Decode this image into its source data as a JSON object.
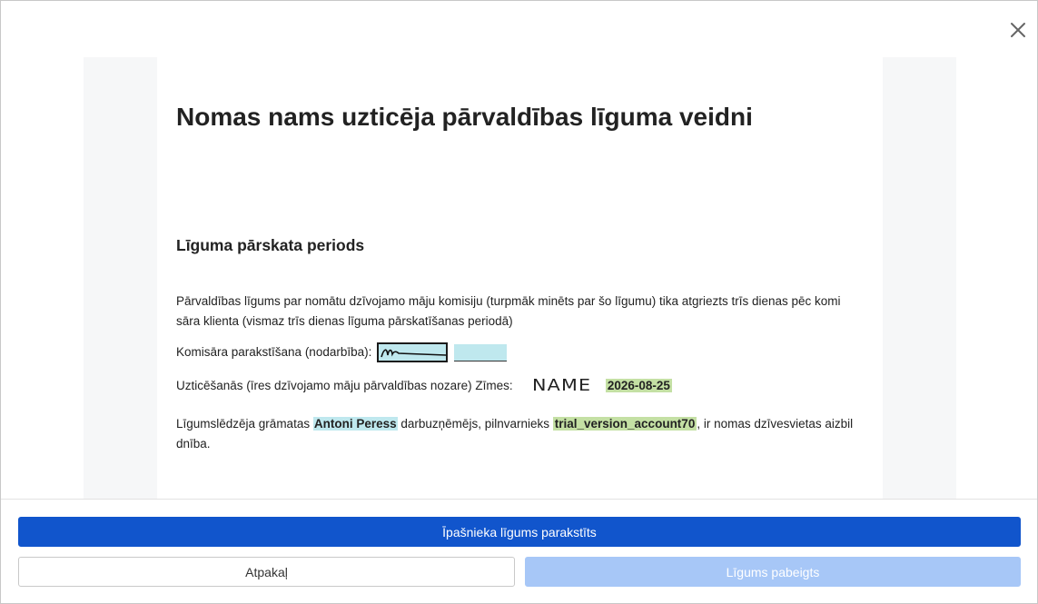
{
  "document": {
    "title": "Nomas nams uzticēja pārvaldības līguma veidni",
    "section_title": "Līguma pārskata periods",
    "paragraph1": "Pārvaldības līgums par nomātu dzīvojamo māju komisiju (turpmāk minēts par šo līgumu) tika atgriezts trīs dienas pēc komi sāra klienta (vismaz trīs dienas līguma pārskatīšanas periodā)",
    "signing_label": "Komisāra parakstīšana (nodarbība):",
    "signing_field_text": "________",
    "trust_label": "Uzticēšanās (īres dzīvojamo māju pārvaldības nozare) Zīmes:",
    "trust_signature": "NAME",
    "trust_date": "2026-08-25",
    "p2_prefix": "Līgumslēdzēja grāmatas",
    "p2_name": "Antoni Peress",
    "p2_middle": "darbuzņēmējs, pilnvarnieks",
    "p2_account": "trial_version_account70",
    "p2_suffix": ", ir nomas dzīvesvietas aizbil dnība."
  },
  "footer": {
    "primary_label": "Īpašnieka līgums parakstīts",
    "back_label": "Atpakaļ",
    "done_label": "Līgums pabeigts"
  },
  "icons": {
    "close": "close-icon",
    "signature": "handwritten-signature-icon"
  },
  "colors": {
    "primary": "#1155cc",
    "disabled": "#a7c7f7",
    "highlight_cyan": "#bfe8ee",
    "highlight_green": "#c4e0a4"
  }
}
